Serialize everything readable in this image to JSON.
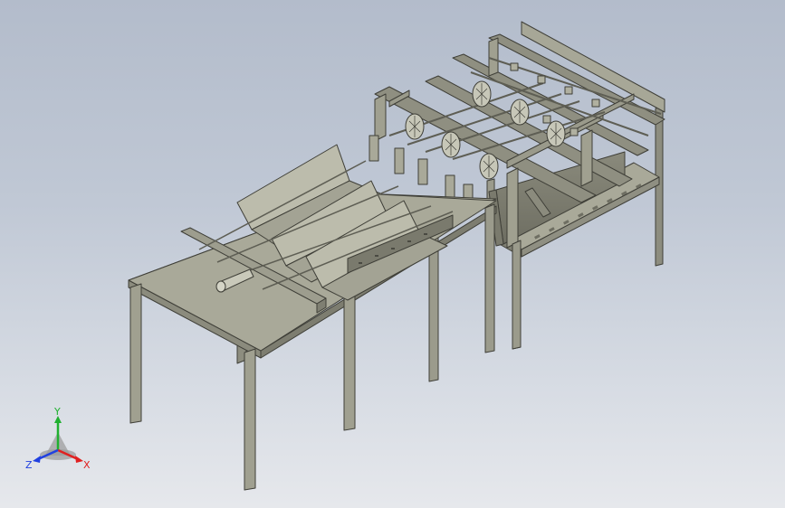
{
  "viewport": {
    "background_top": "#b3bccb",
    "background_bottom": "#e6e8ec",
    "model_color": "#9f9f8f",
    "model_edge_color": "#3f3f38"
  },
  "triad": {
    "x_label": "X",
    "y_label": "Y",
    "z_label": "Z",
    "x_color": "#e02020",
    "y_color": "#20b030",
    "z_color": "#2040e0"
  }
}
